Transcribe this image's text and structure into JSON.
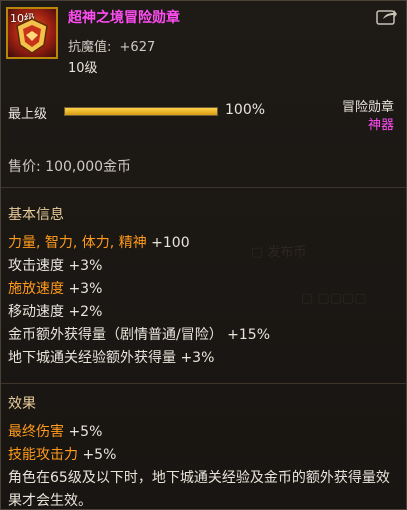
{
  "header": {
    "level_tag": "10级",
    "title": "超神之境冒险勋章",
    "anti_magic_label": "抗魔值:",
    "anti_magic_value": "+627",
    "level": "10级"
  },
  "progress": {
    "label": "最上级",
    "percent_text": "100%",
    "fill_fraction": 1.0,
    "item_type": "冒险勋章",
    "rarity": "神器"
  },
  "price": "售价: 100,000金币",
  "basic_info": {
    "head": "基本信息",
    "stats": [
      {
        "name": "力量, 智力, 体力, 精神",
        "value": " +100",
        "highlight": true
      },
      {
        "name": "攻击速度",
        "value": " +3%",
        "highlight": false
      },
      {
        "name": "施放速度",
        "value": " +3%",
        "highlight": true
      },
      {
        "name": "移动速度",
        "value": " +2%",
        "highlight": false
      },
      {
        "name": "金币额外获得量（剧情普通/冒险）",
        "value": " +15%",
        "highlight": false
      },
      {
        "name": "地下城通关经验额外获得量",
        "value": " +3%",
        "highlight": false
      }
    ]
  },
  "effects": {
    "head": "效果",
    "stats": [
      {
        "name": "最终伤害",
        "value": " +5%",
        "highlight": true
      },
      {
        "name": "技能攻击力",
        "value": " +5%",
        "highlight": true
      }
    ],
    "description": "角色在65级及以下时，地下城通关经验及金币的额外获得量效果才会生效。"
  },
  "colors": {
    "title": "#ff4df3",
    "highlight_stat": "#ff9a1c",
    "section_head": "#e8cc9a",
    "bar_fill": "#ffc42a"
  },
  "icons": {
    "item": "medal-emblem-icon",
    "share": "share-arrow-icon"
  }
}
